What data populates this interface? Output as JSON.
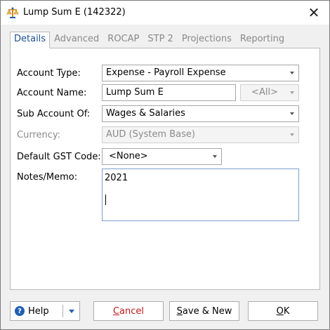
{
  "window": {
    "title": "Lump Sum E (142322)",
    "close_glyph": "✕",
    "icon": "scales-icon"
  },
  "tabs": [
    {
      "label": "Details",
      "active": true
    },
    {
      "label": "Advanced",
      "active": false
    },
    {
      "label": "ROCAP",
      "active": false
    },
    {
      "label": "STP 2",
      "active": false
    },
    {
      "label": "Projections",
      "active": false
    },
    {
      "label": "Reporting",
      "active": false
    }
  ],
  "form": {
    "account_type": {
      "label": "Account Type:",
      "value": "Expense - Payroll Expense"
    },
    "account_name": {
      "label": "Account Name:",
      "value": "Lump Sum E",
      "scope": "<All>"
    },
    "sub_account_of": {
      "label": "Sub Account Of:",
      "value": "Wages & Salaries"
    },
    "currency": {
      "label": "Currency:",
      "value": "AUD (System Base)"
    },
    "default_gst_code": {
      "label": "Default GST Code:",
      "value": "<None>"
    },
    "notes_memo": {
      "label": "Notes/Memo:",
      "value": "2021"
    }
  },
  "footer": {
    "help": {
      "label": "Help",
      "icon": "help-icon"
    },
    "cancel": {
      "prefix": "",
      "mnemonic": "C",
      "rest": "ancel"
    },
    "save_new": {
      "prefix": "",
      "mnemonic": "S",
      "rest": "ave & New"
    },
    "ok": {
      "prefix": "",
      "mnemonic": "O",
      "rest": "K"
    }
  },
  "colors": {
    "active_tab_text": "#1b4f8f",
    "cancel_text": "#c0191b",
    "help_icon": "#1f5fb4",
    "memo_border": "#7aa0cc"
  }
}
